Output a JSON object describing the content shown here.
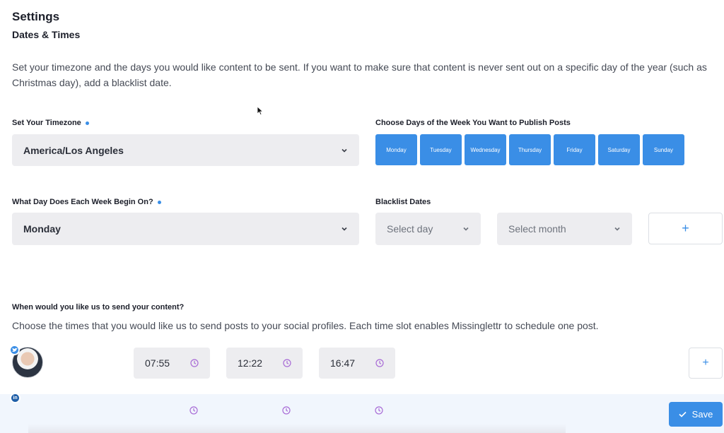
{
  "header": {
    "title": "Settings",
    "section": "Dates & Times"
  },
  "description": "Set your timezone and the days you would like content to be sent. If you want to make sure that content is never sent out on a specific day of the year (such as Christmas day), add a blacklist date.",
  "timezone": {
    "label": "Set Your Timezone",
    "value": "America/Los Angeles"
  },
  "week_start": {
    "label": "What Day Does Each Week Begin On?",
    "value": "Monday"
  },
  "publish_days": {
    "label": "Choose Days of the Week You Want to Publish Posts",
    "days": [
      "Monday",
      "Tuesday",
      "Wednesday",
      "Thursday",
      "Friday",
      "Saturday",
      "Sunday"
    ]
  },
  "blacklist": {
    "label": "Blacklist Dates",
    "day_placeholder": "Select day",
    "month_placeholder": "Select month",
    "add_label": "+"
  },
  "schedule": {
    "title": "When would you like us to send your content?",
    "description": "Choose the times that you would like us to send posts to your social profiles. Each time slot enables Missinglettr to schedule one post.",
    "times": [
      "07:55",
      "12:22",
      "16:47"
    ],
    "add_label": "+",
    "linkedin_badge": "in"
  },
  "footer": {
    "save_label": "Save"
  },
  "colors": {
    "accent": "#3a8ee6",
    "clock": "#a86bd6",
    "field_bg": "#ededf0"
  },
  "icons": [
    "chevron-down-icon",
    "clock-icon",
    "twitter-icon",
    "linkedin-icon",
    "check-icon",
    "plus-icon"
  ]
}
